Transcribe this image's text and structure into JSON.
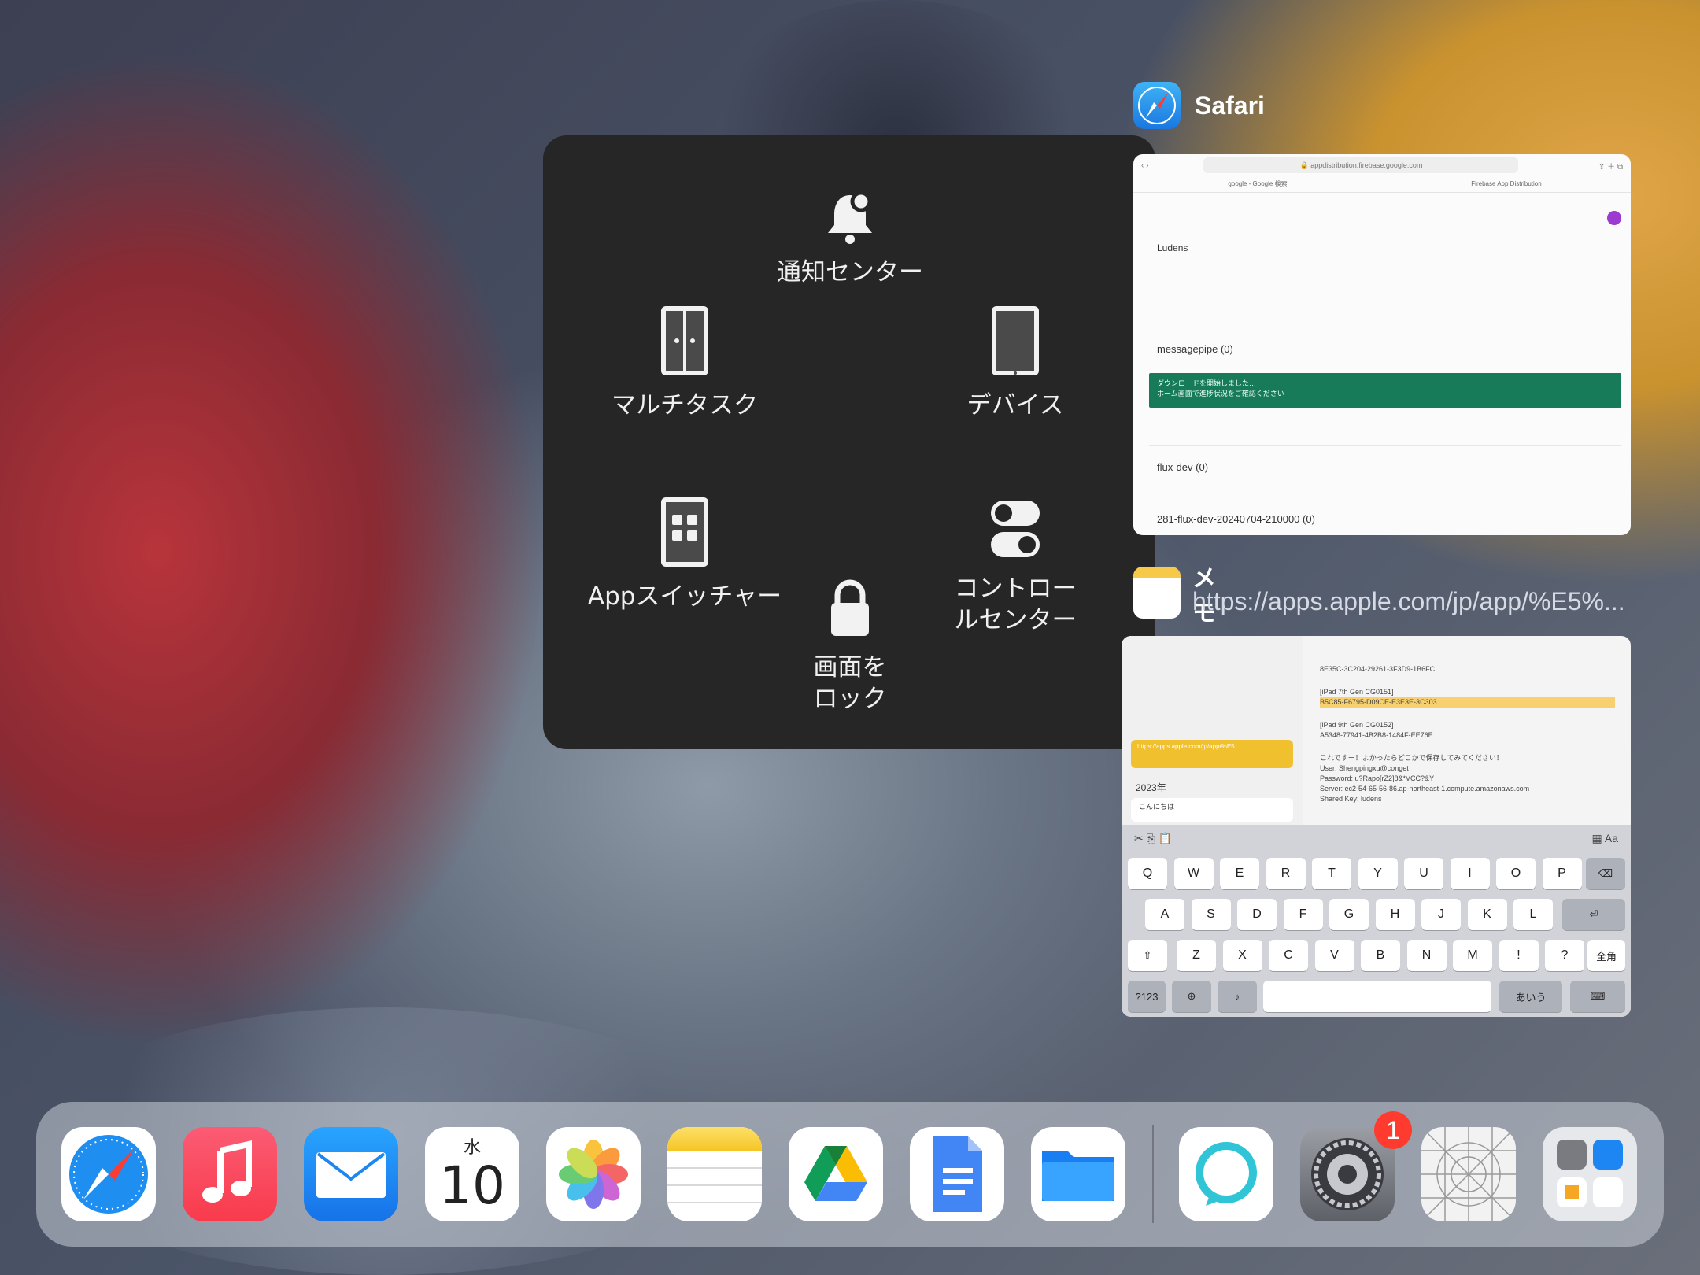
{
  "assistive_menu": {
    "notification": "通知センター",
    "multitask": "マルチタスク",
    "device": "デバイス",
    "app_switcher": "Appスイッチャー",
    "lock_screen": "画面を\nロック",
    "control_center": "コントロー\nルセンター"
  },
  "switcher": {
    "safari": {
      "title": "Safari",
      "url": "appdistribution.firebase.google.com",
      "tab1": "google - Google 検索",
      "tab2": "Firebase App Distribution",
      "app_name": "Ludens",
      "row1": "messagepipe (0)",
      "notice_line1": "ダウンロードを開始しました…",
      "notice_line2": "ホーム画面で進捗状況をご確認ください",
      "row2": "flux-dev (0)",
      "row3": "281-flux-dev-20240704-210000 (0)"
    },
    "memo": {
      "title": "メモ",
      "subtitle": "https://apps.apple.com/jp/app/%E5%...",
      "year": "2023年",
      "note_item": "こんにちは",
      "yellow_item": "https://apps.apple.com/jp/app/%E5...",
      "body": [
        "8E35C-3C204-29261-3F3D9-1B6FC",
        "[iPad 7th Gen CG0151]",
        "B5C85-F6795-D09CE-E3E3E-3C303",
        "[iPad 9th Gen CG0152]",
        "A5348-77941-4B2B8-1484F-EE76E",
        "これですー！よかったらどこかで保存してみてください！",
        "User: Shengpingxu@conget",
        "Password: u?Rapo[rZ2]8&*VCC?&Y",
        "Server: ec2-54-65-56-86.ap-northeast-1.compute.amazonaws.com",
        "Shared Key: ludens"
      ],
      "keys_row1": [
        "Q",
        "W",
        "E",
        "R",
        "T",
        "Y",
        "U",
        "I",
        "O",
        "P"
      ],
      "keys_row2": [
        "A",
        "S",
        "D",
        "F",
        "G",
        "H",
        "J",
        "K",
        "L"
      ],
      "keys_row3": [
        "Z",
        "X",
        "C",
        "V",
        "B",
        "N",
        "M",
        "!",
        "?"
      ],
      "key_123": "?123",
      "key_kana": "あいう",
      "key_zenkaku": "全角"
    }
  },
  "dock": {
    "calendar_day_of_week": "水",
    "calendar_date": "10",
    "settings_badge": "1"
  }
}
